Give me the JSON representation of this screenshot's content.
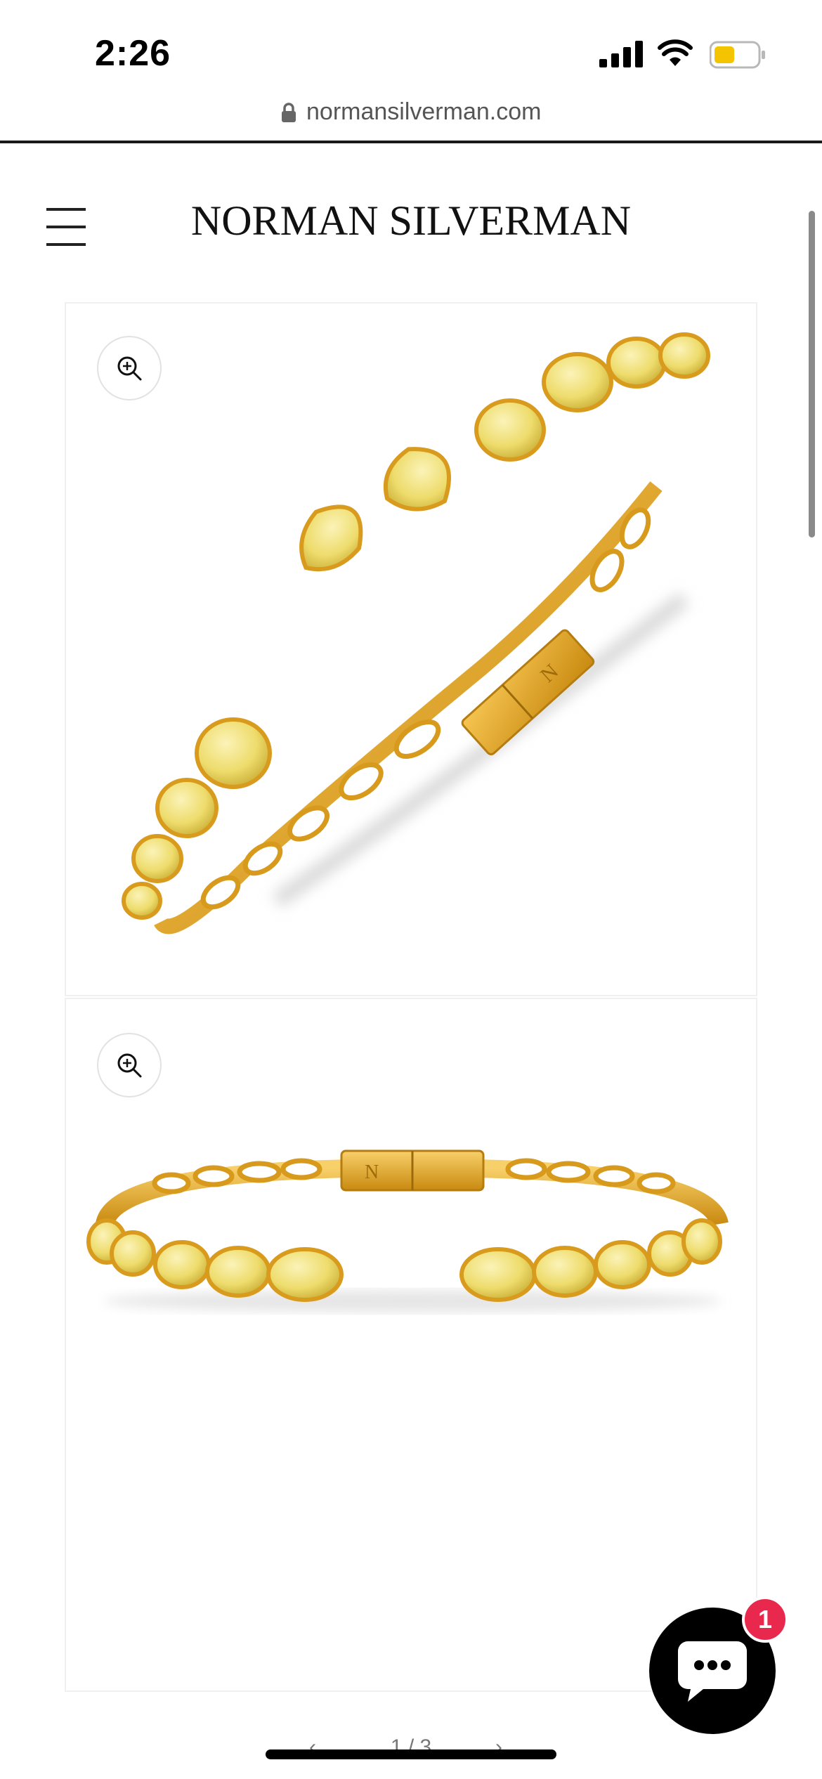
{
  "status_bar": {
    "time": "2:26",
    "icons": [
      "signal-icon",
      "wifi-icon",
      "battery-icon"
    ],
    "battery_color": "#f5c400"
  },
  "browser": {
    "url": "normansilverman.com",
    "lock_icon": "lock-icon"
  },
  "header": {
    "brand": "NORMAN SILVERMAN",
    "menu_icon": "hamburger-menu-icon"
  },
  "gallery": {
    "images": [
      {
        "name": "product-image-1",
        "zoom_icon": "zoom-in-icon"
      },
      {
        "name": "product-image-2",
        "zoom_icon": "zoom-in-icon"
      }
    ],
    "pagination": {
      "prev": "‹",
      "count": "1 / 3",
      "next": "›"
    }
  },
  "chat": {
    "icon": "chat-bubble-icon",
    "badge_count": "1",
    "badge_color": "#e8294d"
  },
  "colors": {
    "gold": "#e0a020",
    "diamond_yellow": "#f3e27a"
  }
}
